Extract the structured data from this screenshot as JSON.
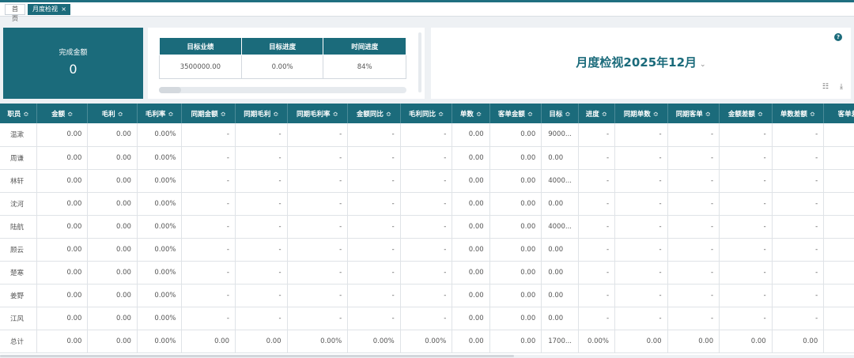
{
  "tabs": {
    "home": "首页",
    "active": "月度检视",
    "close": "×"
  },
  "summary": {
    "label": "完成金额",
    "value": "0"
  },
  "kpi": {
    "headers": [
      "目标业绩",
      "目标进度",
      "时间进度"
    ],
    "values": [
      "3500000.00",
      "0.00%",
      "84%"
    ]
  },
  "report": {
    "title": "月度检视2025年12月",
    "help": "?"
  },
  "table": {
    "sort_icon": "≎",
    "columns": [
      "职员",
      "金额",
      "毛利",
      "毛利率",
      "同期金额",
      "同期毛利",
      "同期毛利率",
      "金额同比",
      "毛利同比",
      "单数",
      "客单金额",
      "目标",
      "进度",
      "同期单数",
      "同期客单",
      "金额差额",
      "单数差额",
      "客单差额"
    ],
    "sortable": [
      true,
      true,
      true,
      true,
      true,
      true,
      true,
      true,
      true,
      true,
      true,
      true,
      true,
      true,
      true,
      true,
      true,
      false
    ],
    "rows": [
      [
        "温漱",
        "0.00",
        "0.00",
        "0.00%",
        "-",
        "-",
        "-",
        "-",
        "-",
        "0.00",
        "0.00",
        "9000...",
        "-",
        "-",
        "-",
        "-",
        "-",
        ""
      ],
      [
        "周谦",
        "0.00",
        "0.00",
        "0.00%",
        "-",
        "-",
        "-",
        "-",
        "-",
        "0.00",
        "0.00",
        "0.00",
        "-",
        "-",
        "-",
        "-",
        "-",
        ""
      ],
      [
        "林轩",
        "0.00",
        "0.00",
        "0.00%",
        "-",
        "-",
        "-",
        "-",
        "-",
        "0.00",
        "0.00",
        "4000...",
        "-",
        "-",
        "-",
        "-",
        "-",
        ""
      ],
      [
        "沈河",
        "0.00",
        "0.00",
        "0.00%",
        "-",
        "-",
        "-",
        "-",
        "-",
        "0.00",
        "0.00",
        "0.00",
        "-",
        "-",
        "-",
        "-",
        "-",
        ""
      ],
      [
        "陆航",
        "0.00",
        "0.00",
        "0.00%",
        "-",
        "-",
        "-",
        "-",
        "-",
        "0.00",
        "0.00",
        "4000...",
        "-",
        "-",
        "-",
        "-",
        "-",
        ""
      ],
      [
        "顾云",
        "0.00",
        "0.00",
        "0.00%",
        "-",
        "-",
        "-",
        "-",
        "-",
        "0.00",
        "0.00",
        "0.00",
        "-",
        "-",
        "-",
        "-",
        "-",
        ""
      ],
      [
        "楚寒",
        "0.00",
        "0.00",
        "0.00%",
        "-",
        "-",
        "-",
        "-",
        "-",
        "0.00",
        "0.00",
        "0.00",
        "-",
        "-",
        "-",
        "-",
        "-",
        ""
      ],
      [
        "姜野",
        "0.00",
        "0.00",
        "0.00%",
        "-",
        "-",
        "-",
        "-",
        "-",
        "0.00",
        "0.00",
        "0.00",
        "-",
        "-",
        "-",
        "-",
        "-",
        ""
      ],
      [
        "江风",
        "0.00",
        "0.00",
        "0.00%",
        "-",
        "-",
        "-",
        "-",
        "-",
        "0.00",
        "0.00",
        "0.00",
        "-",
        "-",
        "-",
        "-",
        "-",
        ""
      ],
      [
        "总计",
        "0.00",
        "0.00",
        "0.00%",
        "0.00",
        "0.00",
        "0.00%",
        "0.00%",
        "0.00%",
        "0.00",
        "0.00",
        "1700...",
        "0.00%",
        "0.00",
        "0.00",
        "0.00",
        "0.00",
        ""
      ]
    ]
  },
  "colors": {
    "primary": "#1b6b7b",
    "header_text": "#ffffff",
    "background": "#eef1f4"
  },
  "icons": {
    "help": "question-circle-icon",
    "list": "list-icon",
    "download": "download-icon",
    "chevron": "chevron-down-icon",
    "sort": "sort-icon"
  }
}
